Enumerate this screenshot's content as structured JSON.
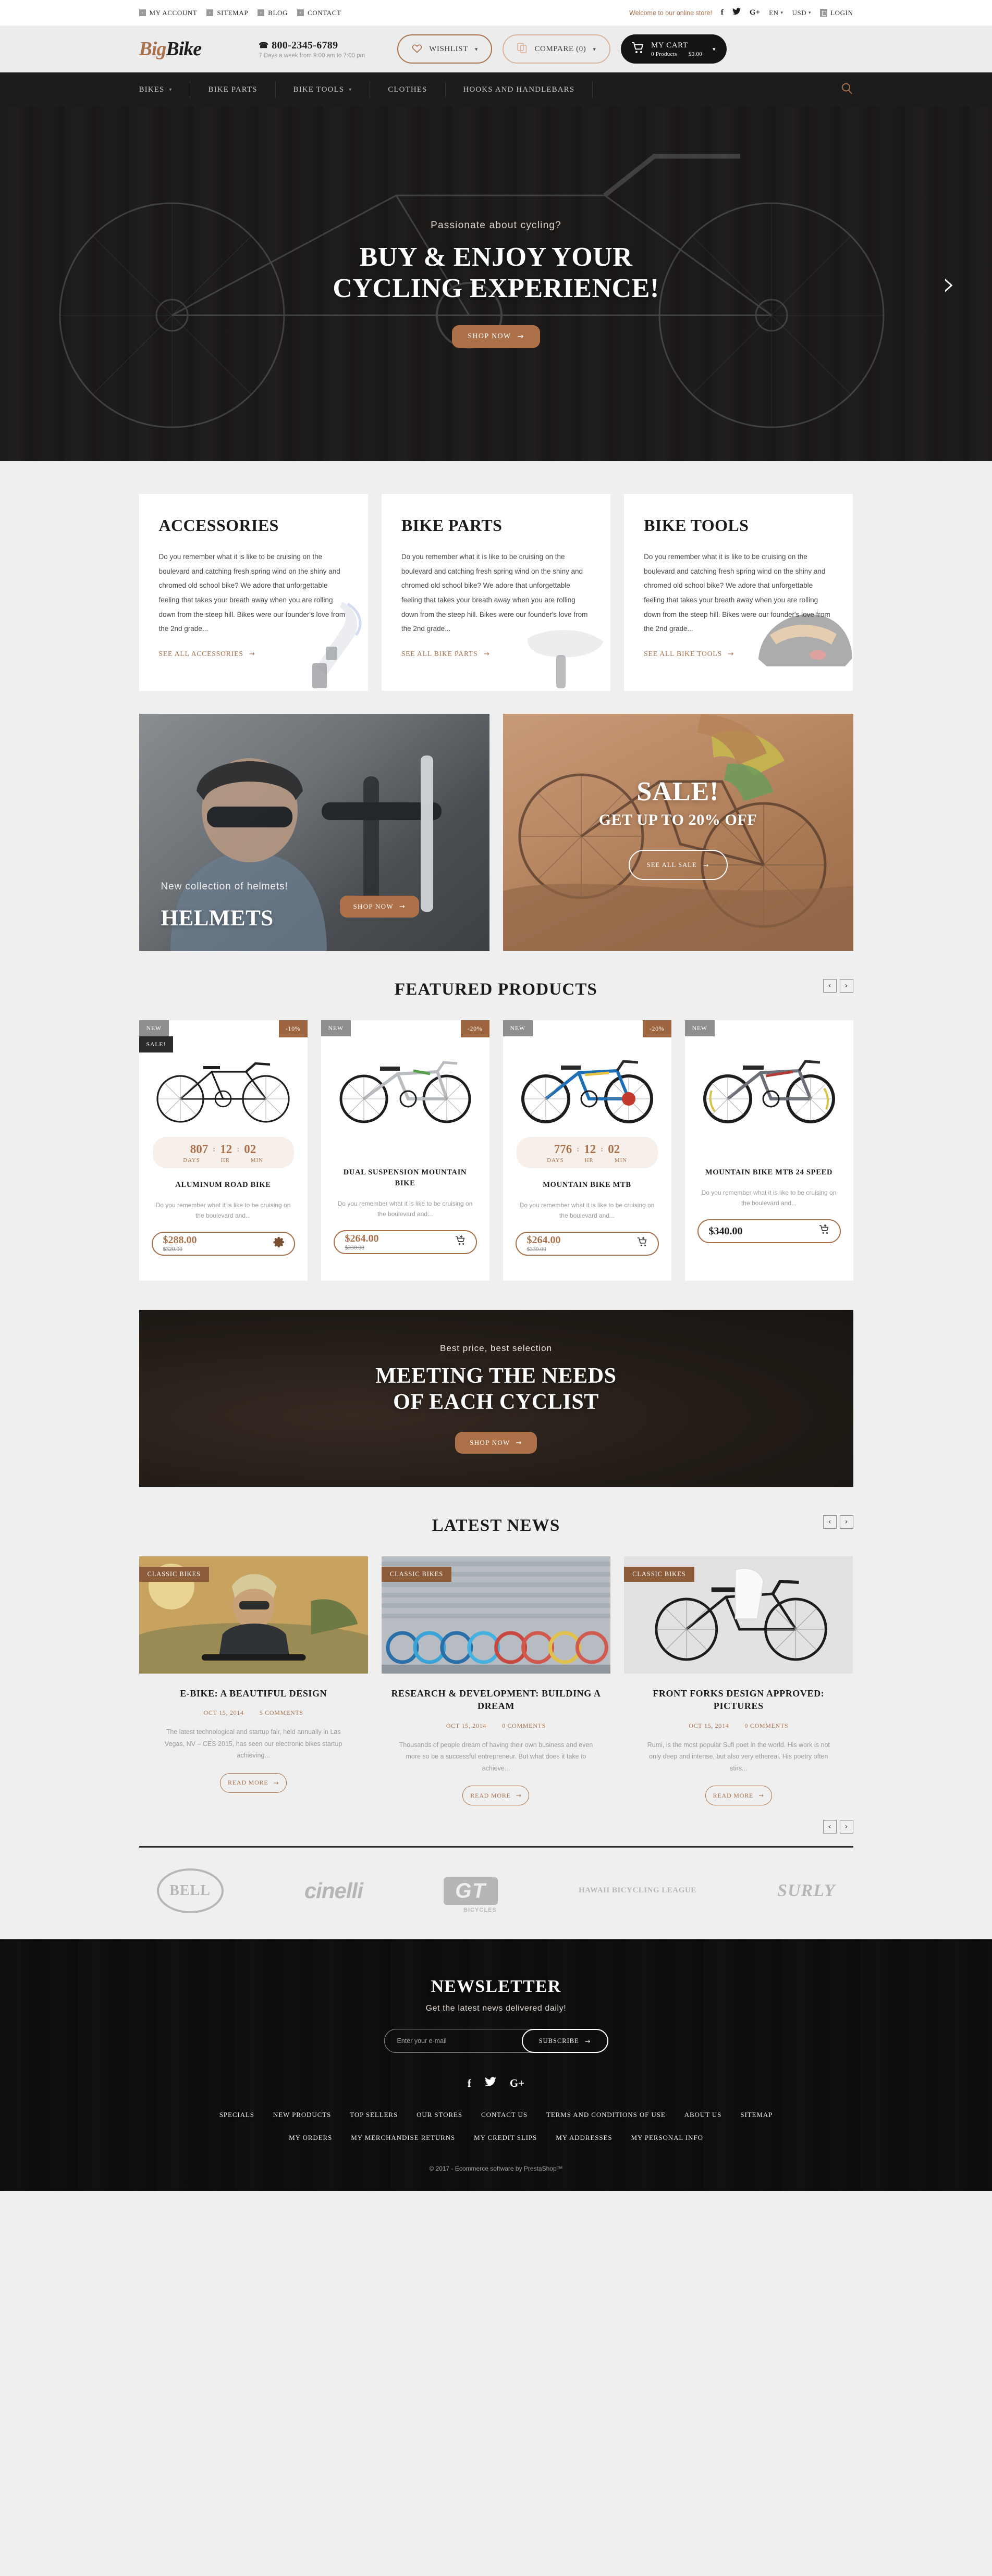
{
  "topbar": {
    "links": [
      "MY ACCOUNT",
      "SITEMAP",
      "BLOG",
      "CONTACT"
    ],
    "welcome": "Welcome to our online store!",
    "social": [
      "f",
      "𝕥",
      "G+"
    ],
    "language": "EN",
    "currency": "USD",
    "login": "LOGIN"
  },
  "header": {
    "logo_first": "Big",
    "logo_second": "Bike",
    "phone": "800-2345-6789",
    "phone_hours": "7 Days a week from 9:00 am to 7:00 pm",
    "wishlist": "WISHLIST",
    "compare": "COMPARE (0)",
    "cart_title": "MY CART",
    "cart_products": "0 Products",
    "cart_total": "$0.00"
  },
  "nav": {
    "items": [
      {
        "label": "BIKES",
        "has_caret": true
      },
      {
        "label": "BIKE PARTS",
        "has_caret": false
      },
      {
        "label": "BIKE TOOLS",
        "has_caret": true
      },
      {
        "label": "CLOTHES",
        "has_caret": false
      },
      {
        "label": "HOOKS AND HANDLEBARS",
        "has_caret": false
      }
    ]
  },
  "hero": {
    "kicker": "Passionate about cycling?",
    "line1": "BUY & ENJOY YOUR",
    "line2": "CYCLING EXPERIENCE!",
    "cta": "SHOP NOW"
  },
  "info_cards": [
    {
      "title": "ACCESSORIES",
      "text": "Do you remember what it is like to be cruising on the boulevard and catching fresh spring wind on the shiny and chromed old school bike? We adore that unforgettable feeling that takes your breath away when you are rolling down from the steep hill. Bikes were our founder's love from the 2nd grade...",
      "link": "SEE ALL ACCESSORIES"
    },
    {
      "title": "BIKE PARTS",
      "text": "Do you remember what it is like to be cruising on the boulevard and catching fresh spring wind on the shiny and chromed old school bike? We adore that unforgettable feeling that takes your breath away when you are rolling down from the steep hill. Bikes were our founder's love from the 2nd grade...",
      "link": "SEE ALL BIKE PARTS"
    },
    {
      "title": "BIKE TOOLS",
      "text": "Do you remember what it is like to be cruising on the boulevard and catching fresh spring wind on the shiny and chromed old school bike? We adore that unforgettable feeling that takes your breath away when you are rolling down from the steep hill. Bikes were our founder's love from the 2nd grade...",
      "link": "SEE ALL BIKE TOOLS"
    }
  ],
  "promo_helmets": {
    "kicker": "New collection of helmets!",
    "title": "HELMETS",
    "cta": "SHOP NOW"
  },
  "promo_sale": {
    "title": "SALE!",
    "subtitle": "GET UP TO 20% OFF",
    "cta": "SEE ALL SALE"
  },
  "featured": {
    "heading": "FEATURED PRODUCTS",
    "prev": "‹",
    "next": "›",
    "products": [
      {
        "badge_new": "NEW",
        "badge_sale": "SALE!",
        "discount": "-10%",
        "timer": {
          "days": "807",
          "hours": "12",
          "minutes": "02",
          "l_days": "DAYS",
          "l_hr": "HR",
          "l_min": "MIN"
        },
        "name": "ALUMINUM ROAD BIKE",
        "desc": "Do you remember what it is like to be cruising on the boulevard and...",
        "price": "$288.00",
        "old_price": "$320.00",
        "action_icon": "gear-icon"
      },
      {
        "badge_new": "NEW",
        "badge_sale": "",
        "discount": "-20%",
        "timer": null,
        "name": "DUAL SUSPENSION MOUNTAIN BIKE",
        "desc": "Do you remember what it is like to be cruising on the boulevard and...",
        "price": "$264.00",
        "old_price": "$330.00",
        "action_icon": "cart-plus-icon"
      },
      {
        "badge_new": "NEW",
        "badge_sale": "",
        "discount": "-20%",
        "timer": {
          "days": "776",
          "hours": "12",
          "minutes": "02",
          "l_days": "DAYS",
          "l_hr": "HR",
          "l_min": "MIN"
        },
        "name": "MOUNTAIN BIKE MTB",
        "desc": "Do you remember what it is like to be cruising on the boulevard and...",
        "price": "$264.00",
        "old_price": "$330.00",
        "action_icon": "cart-plus-icon"
      },
      {
        "badge_new": "NEW",
        "badge_sale": "",
        "discount": "",
        "timer": null,
        "name": "MOUNTAIN BIKE MTB 24 SPEED",
        "desc": "Do you remember what it is like to be cruising on the boulevard and...",
        "price": "$340.00",
        "old_price": "",
        "action_icon": "cart-plus-icon"
      }
    ]
  },
  "mid_banner": {
    "kicker": "Best price, best selection",
    "line1": "MEETING THE NEEDS",
    "line2": "OF EACH CYCLIST",
    "cta": "SHOP NOW"
  },
  "news": {
    "heading": "LATEST NEWS",
    "prev": "‹",
    "next": "›",
    "posts": [
      {
        "category": "CLASSIC BIKES",
        "title": "E-BIKE: A BEAUTIFUL DESIGN",
        "date": "OCT 15, 2014",
        "comments": "5 COMMENTS",
        "excerpt": "The latest technological and startup fair, held annually in Las Vegas, NV – CES 2015, has seen our electronic bikes startup achieving...",
        "button": "READ MORE"
      },
      {
        "category": "CLASSIC BIKES",
        "title": "RESEARCH & DEVELOPMENT: BUILDING A DREAM",
        "date": "OCT 15, 2014",
        "comments": "0 COMMENTS",
        "excerpt": "Thousands of people dream of having their own business and even more so be a successful entrepreneur. But what does it take to achieve...",
        "button": "READ MORE"
      },
      {
        "category": "CLASSIC BIKES",
        "title": "FRONT FORKS DESIGN APPROVED: PICTURES",
        "date": "OCT 15, 2014",
        "comments": "0 COMMENTS",
        "excerpt": "Rumi, is the most popular Sufi poet in the world. His work is not only deep and intense, but also very ethereal. His poetry often stirs...",
        "button": "READ MORE"
      }
    ],
    "bottom_prev": "‹",
    "bottom_next": "›"
  },
  "brands": [
    {
      "name": "BELL",
      "style": "bell"
    },
    {
      "name": "cinelli",
      "style": "cinelli"
    },
    {
      "name": "GT",
      "sub": "BICYCLES",
      "style": "gt"
    },
    {
      "name": "HAWAII BICYCLING LEAGUE",
      "style": "hbl"
    },
    {
      "name": "SURLY",
      "style": "surly"
    }
  ],
  "newsletter": {
    "title": "NEWSLETTER",
    "subtitle": "Get the latest news delivered daily!",
    "placeholder": "Enter your e-mail",
    "value": "",
    "button": "SUBSCRIBE"
  },
  "footer": {
    "social": [
      "f",
      "𝕥",
      "G+"
    ],
    "links_row1": [
      "SPECIALS",
      "NEW PRODUCTS",
      "TOP SELLERS",
      "OUR STORES",
      "CONTACT US",
      "TERMS AND CONDITIONS OF USE",
      "ABOUT US",
      "SITEMAP"
    ],
    "links_row2": [
      "MY ORDERS",
      "MY MERCHANDISE RETURNS",
      "MY CREDIT SLIPS",
      "MY ADDRESSES",
      "MY PERSONAL INFO"
    ],
    "copyright": "© 2017 - Ecommerce software by PrestaShop™"
  },
  "colors": {
    "accent": "#a9714b",
    "dark": "#1c1c1c",
    "page_bg": "#efefef"
  }
}
